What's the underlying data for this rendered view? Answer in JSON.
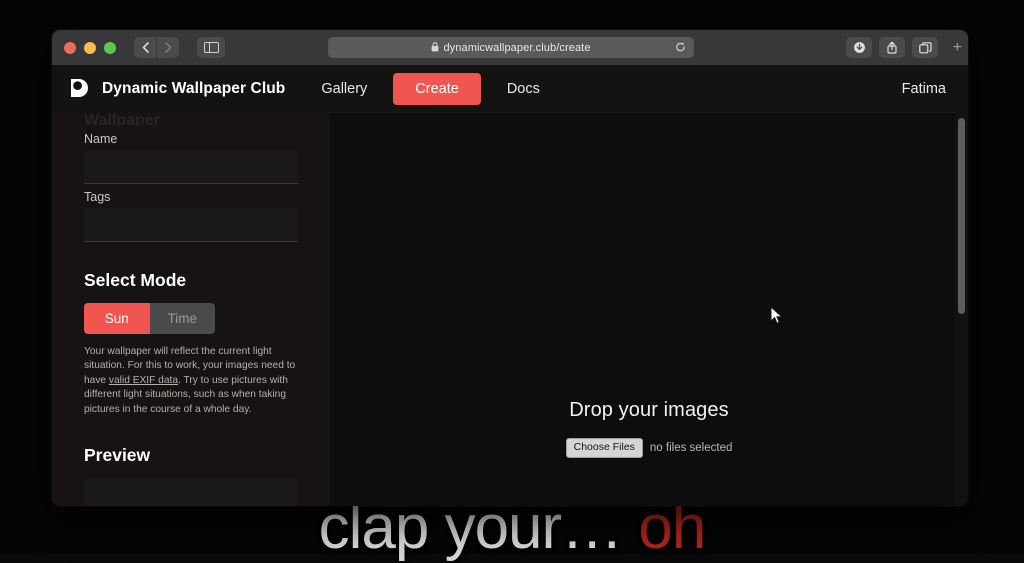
{
  "desktop": {
    "background_text_main": "clap your… ",
    "background_text_accent": "oh"
  },
  "browser": {
    "traffic_lights": [
      "close-red",
      "minimize-yellow",
      "zoom-green"
    ],
    "back_label": "‹",
    "forward_label": "›",
    "sidebar_toggle": "sidebar-icon",
    "url": "dynamicwallpaper.club/create",
    "lock_glyph": "🔒",
    "reload_glyph": "↻",
    "toolbar_buttons": [
      "downloads-icon",
      "share-icon",
      "tabs-icon"
    ],
    "new_tab_label": "+"
  },
  "site": {
    "brand": "Dynamic Wallpaper Club",
    "nav": {
      "gallery": "Gallery",
      "create": "Create",
      "docs": "Docs",
      "user": "Fatima"
    },
    "accent_color": "#f0564f"
  },
  "form": {
    "clipped_heading": "Wallpaper",
    "name_label": "Name",
    "name_value": "",
    "name_placeholder": "",
    "tags_label": "Tags",
    "tags_value": "",
    "tags_placeholder": "",
    "select_mode_title": "Select Mode",
    "mode_sun": "Sun",
    "mode_time": "Time",
    "mode_selected": "Sun",
    "mode_description_part1": "Your wallpaper will reflect the current light situation. For this to work, your images need to have ",
    "mode_description_link": "valid EXIF data",
    "mode_description_part2": ". Try to use pictures with different light situations, such as when taking pictures in the course of a whole day.",
    "preview_title": "Preview"
  },
  "dropzone": {
    "title": "Drop your images",
    "choose_files_label": "Choose Files",
    "file_status": "no files selected"
  }
}
